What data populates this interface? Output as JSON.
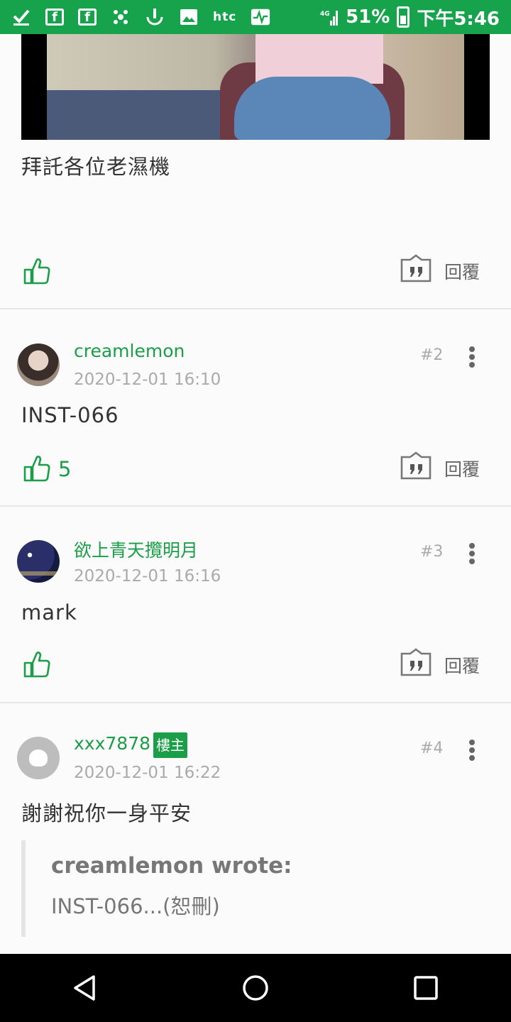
{
  "status_bar": {
    "time": "下午5:46",
    "battery": "51%",
    "carrier_label": "htc",
    "network": "4G",
    "icons": [
      "check-icon",
      "facebook-icon",
      "facebook-icon",
      "app-icon",
      "touch-icon",
      "image-icon",
      "htc-icon",
      "activity-icon"
    ]
  },
  "colors": {
    "brand": "#17a24c",
    "accent": "#1a9e48",
    "muted": "#aaaaaa"
  },
  "posts": [
    {
      "body": "拜託各位老濕機",
      "likes": "",
      "reply_label": "回覆"
    },
    {
      "username": "creamlemon",
      "timestamp": "2020-12-01 16:10",
      "floor": "#2",
      "body": "INST-066",
      "likes": "5",
      "reply_label": "回覆"
    },
    {
      "username": "欲上青天攬明月",
      "timestamp": "2020-12-01 16:16",
      "floor": "#3",
      "body": "mark",
      "likes": "",
      "reply_label": "回覆"
    },
    {
      "username": "xxx7878",
      "badge": "樓主",
      "timestamp": "2020-12-01 16:22",
      "floor": "#4",
      "body": "謝謝祝你一身平安",
      "quote": {
        "author": "creamlemon wrote:",
        "text": "INST-066...(恕刪)"
      }
    }
  ]
}
